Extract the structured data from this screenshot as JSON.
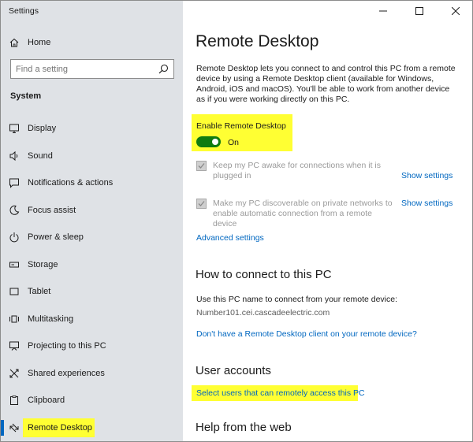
{
  "window": {
    "title": "Settings",
    "controls": [
      "minimize",
      "maximize",
      "close"
    ]
  },
  "sidebar": {
    "home_label": "Home",
    "search_placeholder": "Find a setting",
    "section_title": "System",
    "items": [
      {
        "label": "Display",
        "icon": "display-icon"
      },
      {
        "label": "Sound",
        "icon": "sound-icon"
      },
      {
        "label": "Notifications & actions",
        "icon": "notifications-icon"
      },
      {
        "label": "Focus assist",
        "icon": "focus-assist-icon"
      },
      {
        "label": "Power & sleep",
        "icon": "power-icon"
      },
      {
        "label": "Storage",
        "icon": "storage-icon"
      },
      {
        "label": "Tablet",
        "icon": "tablet-icon"
      },
      {
        "label": "Multitasking",
        "icon": "multitasking-icon"
      },
      {
        "label": "Projecting to this PC",
        "icon": "projecting-icon"
      },
      {
        "label": "Shared experiences",
        "icon": "shared-experiences-icon"
      },
      {
        "label": "Clipboard",
        "icon": "clipboard-icon"
      },
      {
        "label": "Remote Desktop",
        "icon": "remote-desktop-icon",
        "selected": true
      }
    ]
  },
  "main": {
    "title": "Remote Desktop",
    "description": "Remote Desktop lets you connect to and control this PC from a remote device by using a Remote Desktop client (available for Windows, Android, iOS and macOS). You'll be able to work from another device as if you were working directly on this PC.",
    "enable_label": "Enable Remote Desktop",
    "toggle_state": "On",
    "toggle_on": true,
    "options": [
      {
        "text": "Keep my PC awake for connections when it is plugged in",
        "checked": true,
        "disabled": true,
        "link": "Show settings"
      },
      {
        "text": "Make my PC discoverable on private networks to enable automatic connection from a remote device",
        "checked": true,
        "disabled": true,
        "link": "Show settings"
      }
    ],
    "advanced_link": "Advanced settings",
    "connect_heading": "How to connect to this PC",
    "connect_text": "Use this PC name to connect from your remote device:",
    "pc_name": "Number101.cei.cascadeelectric.com",
    "client_link": "Don't have a Remote Desktop client on your remote device?",
    "accounts_heading": "User accounts",
    "select_users_link": "Select users that can remotely access this PC",
    "help_heading": "Help from the web"
  },
  "colors": {
    "sidebar_bg": "#dfe2e6",
    "accent": "#0067c0",
    "toggle_on": "#107c10",
    "highlight": "#ffff33"
  }
}
